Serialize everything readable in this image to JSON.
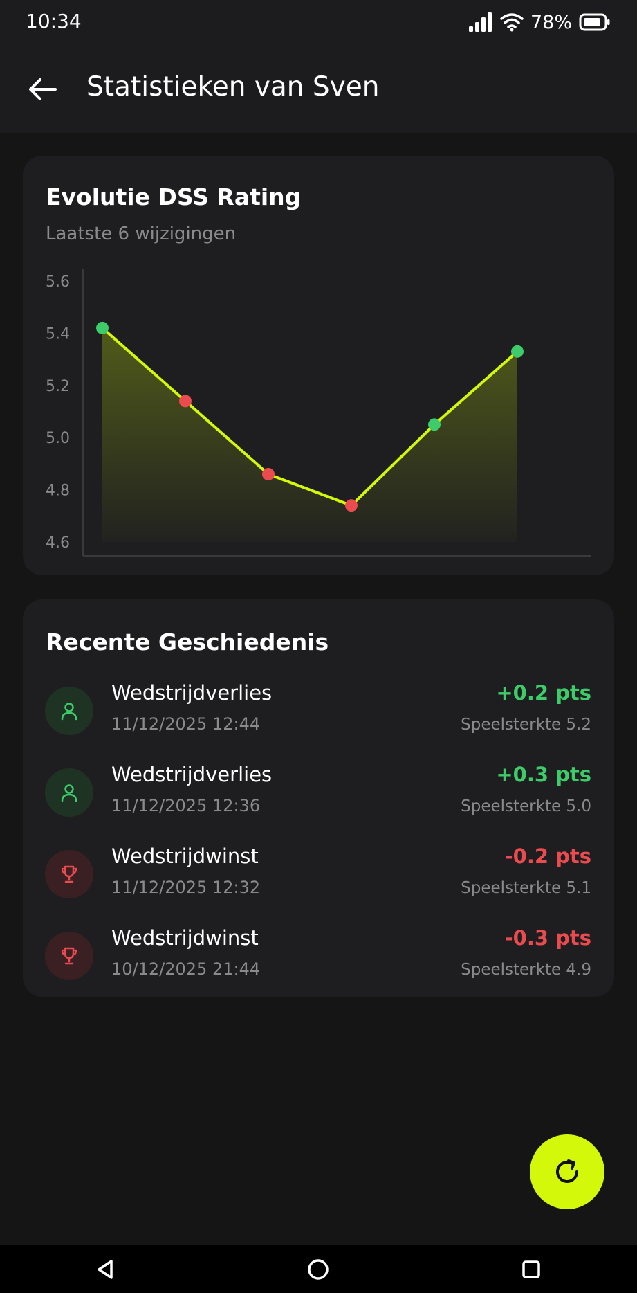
{
  "status_bar": {
    "time": "10:34",
    "battery_percent": "78%",
    "icons": [
      "signal-icon",
      "wifi-icon",
      "battery-icon"
    ]
  },
  "app_bar": {
    "back_icon": "arrow-left-icon",
    "title": "Statistieken van Sven"
  },
  "rating_card": {
    "title": "Evolutie DSS Rating",
    "subtitle": "Laatste 6 wijzigingen"
  },
  "chart_data": {
    "type": "area",
    "title": "Evolutie DSS Rating",
    "subtitle": "Laatste 6 wijzigingen",
    "x": [
      1,
      2,
      3,
      4,
      5,
      6
    ],
    "y_ticks": [
      "5.6",
      "5.4",
      "5.2",
      "5.0",
      "4.8",
      "4.6"
    ],
    "ylim": [
      4.6,
      5.6
    ],
    "series": [
      {
        "values": [
          5.42,
          5.14,
          4.86,
          4.74,
          5.05,
          5.33
        ],
        "point_colors": [
          "#3ecb6a",
          "#ea4b4f",
          "#ea4b4f",
          "#ea4b4f",
          "#3ecb6a",
          "#3ecb6a"
        ]
      }
    ],
    "line_color": "#d4f80a",
    "grid": false,
    "legend": "none"
  },
  "history_card": {
    "title": "Recente Geschiedenis",
    "items": [
      {
        "icon": "user-icon",
        "tone": "green",
        "title": "Wedstrijdverlies",
        "date": "11/12/2025 12:44",
        "points": "+0.2 pts",
        "points_tone": "pos",
        "strength": "Speelsterkte 5.2"
      },
      {
        "icon": "user-icon",
        "tone": "green",
        "title": "Wedstrijdverlies",
        "date": "11/12/2025 12:36",
        "points": "+0.3 pts",
        "points_tone": "pos",
        "strength": "Speelsterkte 5.0"
      },
      {
        "icon": "trophy-icon",
        "tone": "red",
        "title": "Wedstrijdwinst",
        "date": "11/12/2025 12:32",
        "points": "-0.2 pts",
        "points_tone": "neg",
        "strength": "Speelsterkte 5.1"
      },
      {
        "icon": "trophy-icon",
        "tone": "red",
        "title": "Wedstrijdwinst",
        "date": "10/12/2025 21:44",
        "points": "-0.3 pts",
        "points_tone": "neg",
        "strength": "Speelsterkte 4.9"
      }
    ]
  },
  "fab": {
    "icon": "refresh-icon"
  },
  "nav_bar": {
    "icons": [
      "back-triangle-icon",
      "home-circle-icon",
      "recents-square-icon"
    ]
  },
  "colors": {
    "accent": "#d4f80a",
    "positive": "#3ecb6a",
    "negative": "#ea4b4f",
    "background": "#151515",
    "card": "#1e1e20"
  }
}
